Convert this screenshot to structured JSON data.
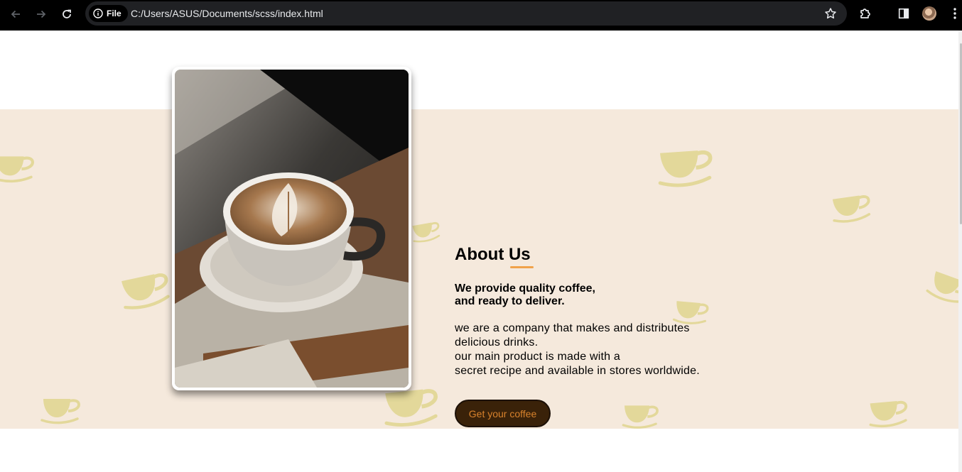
{
  "browser": {
    "back_icon": "arrow-left-icon",
    "forward_icon": "arrow-right-icon",
    "reload_icon": "reload-icon",
    "site_info_label": "File",
    "url": "C:/Users/ASUS/Documents/scss/index.html",
    "bookmark_icon": "star-icon",
    "extensions_icon": "puzzle-icon",
    "side_panel_icon": "side-panel-icon",
    "menu_icon": "kebab-menu-icon"
  },
  "about": {
    "title": "About Us",
    "tagline_line1": "We provide quality coffee,",
    "tagline_line2": "and ready to deliver.",
    "desc_line1": "we are a company that makes and distributes",
    "desc_line2": "delicious drinks.",
    "desc_line3": "our main product is made with a",
    "desc_line4": "secret recipe and available in stores worldwide.",
    "cta_label": "Get your coffee",
    "image": "latte-art-coffee-cup-photo",
    "background_pattern": "coffee-cup-icon"
  },
  "colors": {
    "browser_bar": "#000000",
    "omnibox": "#202124",
    "band_background": "#f5e9dc",
    "pattern": "#e3d89a",
    "accent_underline": "#f0a24a",
    "cta_background": "#3a2209",
    "cta_text": "#d8822c"
  }
}
